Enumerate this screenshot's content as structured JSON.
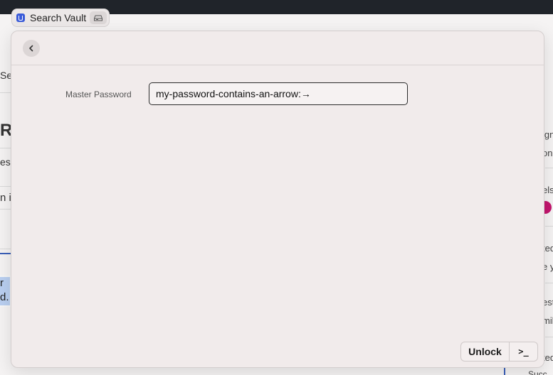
{
  "tab": {
    "label": "Search Vault"
  },
  "background": {
    "left_fragments": [
      "Se",
      "R",
      "ess",
      "n in",
      "r a",
      "d."
    ],
    "right_fragments": [
      "ign",
      "one",
      "els",
      "ted",
      "e y",
      "est",
      "mil",
      "ted",
      "Succ"
    ]
  },
  "dialog": {
    "field_label": "Master Password",
    "password_value": "my-password-contains-an-arrow:→",
    "unlock_label": "Unlock",
    "terminal_label": ">_"
  },
  "colors": {
    "accent_pink": "#c4156e",
    "app_icon_blue": "#3a5bd9"
  }
}
